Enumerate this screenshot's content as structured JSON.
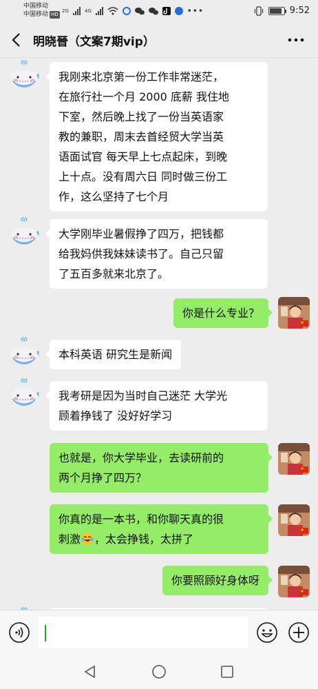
{
  "status_bar": {
    "carrier_1": "中国移动",
    "carrier_2": "中国移动",
    "hd_badge": "HD",
    "net_1": "2G",
    "net_2": "4G",
    "time": "9:52",
    "battery_level": 0.85
  },
  "header": {
    "title": "明晓晉（文案7期vip）",
    "back_icon": "chevron-left-icon",
    "more_icon": "more-dots-icon"
  },
  "messages": [
    {
      "side": "left",
      "lines": [
        "我刚来北京第一份工作非常迷茫，",
        "在旅行社一个月 2000 底薪 我住地",
        "下室，然后晚上找了一份当英语家",
        "教的兼职，周末去首经贸大学当英",
        "语面试官 每天早上七点起床，到晚",
        "上十点。没有周六日 同时做三份工",
        "作，这么坚持了七个月"
      ]
    },
    {
      "side": "left",
      "lines": [
        "大学刚毕业暑假挣了四万，把钱都",
        "给我妈供我妹妹读书了。自己只留",
        "了五百多就来北京了。"
      ]
    },
    {
      "side": "right",
      "lines": [
        "你是什么专业？"
      ]
    },
    {
      "side": "left",
      "lines": [
        "本科英语 研究生是新闻"
      ]
    },
    {
      "side": "left",
      "lines": [
        "我考研是因为当时自己迷茫 大学光",
        "顾着挣钱了 没好好学习"
      ]
    },
    {
      "side": "right",
      "lines": [
        "也就是，你大学毕业，去读研前的",
        "两个月挣了四万？"
      ]
    },
    {
      "side": "right",
      "lines": [
        "你真的是一本书，和你聊天真的很",
        "刺激",
        "，太会挣钱，太拼了"
      ]
    },
    {
      "side": "right",
      "lines": [
        "你要照顾好身体呀"
      ]
    }
  ],
  "input_bar": {
    "value": "",
    "voice_icon": "voice-icon",
    "emoji_icon": "emoji-icon",
    "plus_icon": "plus-icon"
  },
  "nav_bar": {
    "back_icon": "triangle-back-icon",
    "home_icon": "circle-home-icon",
    "recent_icon": "square-recent-icon"
  },
  "colors": {
    "background": "#ededed",
    "bubble_left": "#ffffff",
    "bubble_right": "#95ec69",
    "caret": "#1aad19"
  }
}
